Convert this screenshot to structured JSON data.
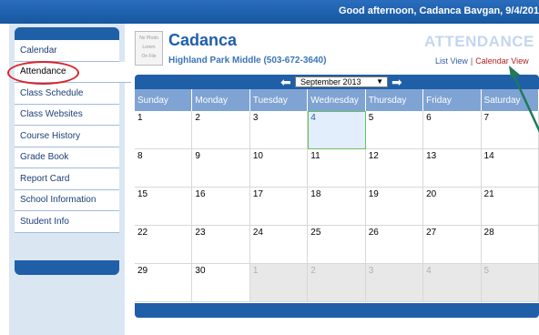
{
  "header": {
    "greeting": "Good afternoon, Cadanca Bavgan, 9/4/201"
  },
  "sidebar": {
    "items": [
      {
        "label": "Calendar"
      },
      {
        "label": "Attendance",
        "active": true
      },
      {
        "label": "Class Schedule"
      },
      {
        "label": "Class Websites"
      },
      {
        "label": "Course History"
      },
      {
        "label": "Grade Book"
      },
      {
        "label": "Report Card"
      },
      {
        "label": "School Information"
      },
      {
        "label": "Student Info"
      }
    ]
  },
  "student": {
    "photo_text": [
      "No Photo",
      "Lorem",
      "On File"
    ],
    "name": "Cadanca",
    "school": "Highland Park Middle (503-672-3640)"
  },
  "page": {
    "title": "ATTENDANCE",
    "list_view": "List View",
    "separator": "|",
    "calendar_view": "Calendar View"
  },
  "calendar": {
    "month": "September 2013",
    "day_headers": [
      "Sunday",
      "Monday",
      "Tuesday",
      "Wednesday",
      "Thursday",
      "Friday",
      "Saturday"
    ],
    "weeks": [
      [
        "1",
        "2",
        "3",
        "4",
        "5",
        "6",
        "7"
      ],
      [
        "8",
        "9",
        "10",
        "11",
        "12",
        "13",
        "14"
      ],
      [
        "15",
        "16",
        "17",
        "18",
        "19",
        "20",
        "21"
      ],
      [
        "22",
        "23",
        "24",
        "25",
        "26",
        "27",
        "28"
      ],
      [
        "29",
        "30",
        "1",
        "2",
        "3",
        "4",
        "5"
      ]
    ],
    "today": "4",
    "other_month_cells": [
      [
        4,
        2
      ],
      [
        4,
        3
      ],
      [
        4,
        4
      ],
      [
        4,
        5
      ],
      [
        4,
        6
      ]
    ]
  },
  "colors": {
    "brand_blue": "#1f5fa8",
    "highlight_red": "#d9252a",
    "arrow_green": "#1f7a5a"
  },
  "icons": {
    "prev": "arrow-left-icon",
    "next": "arrow-right-icon",
    "dropdown": "caret-down-icon"
  }
}
